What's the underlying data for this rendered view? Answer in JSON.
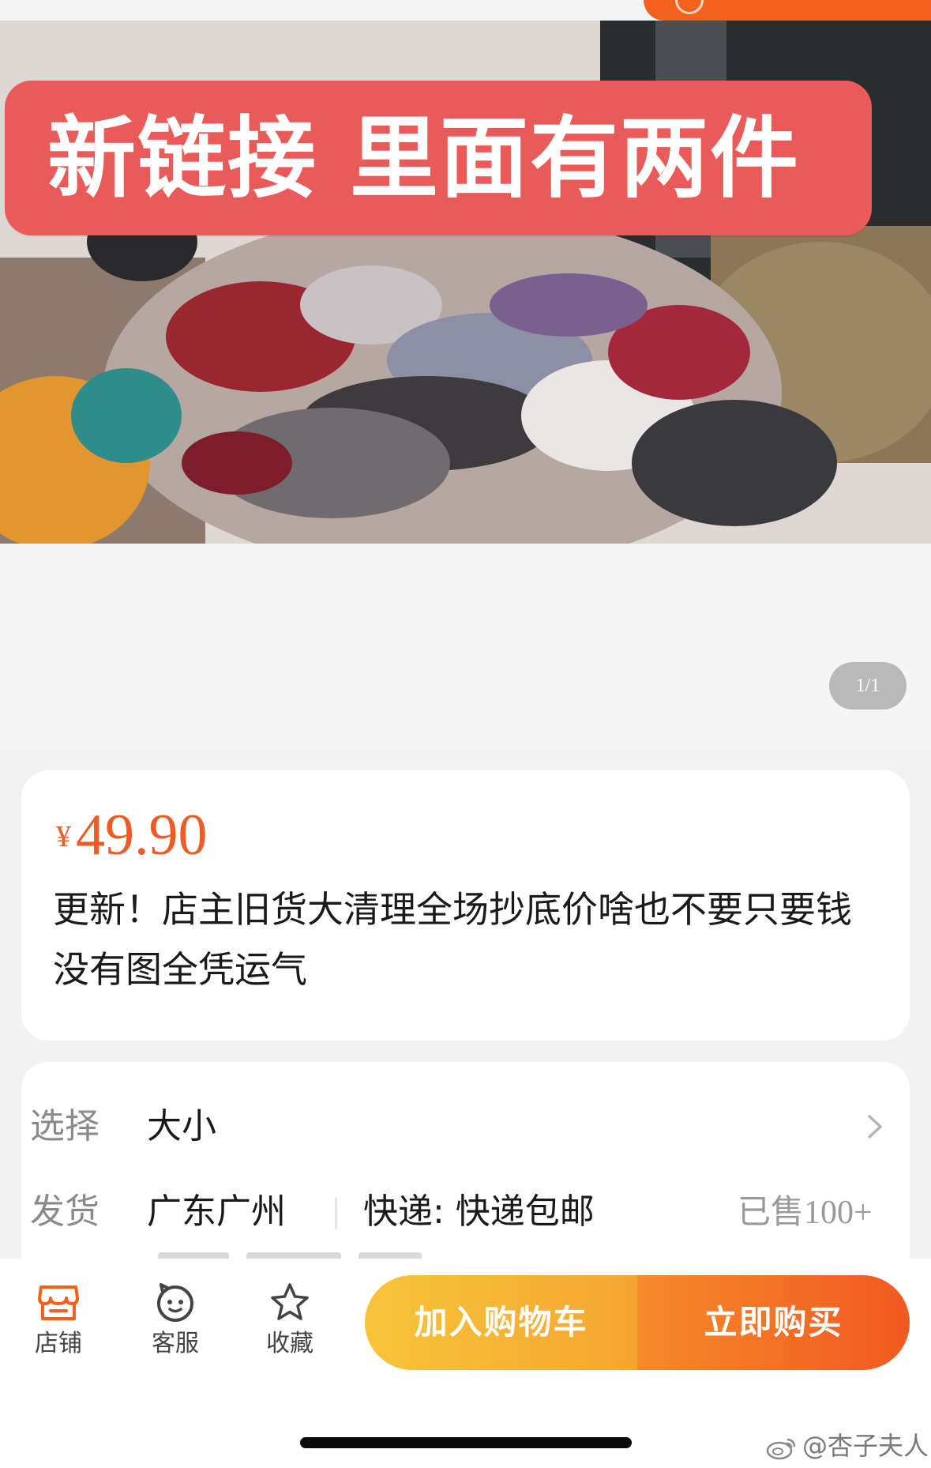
{
  "hero": {
    "banner_text": "新链接 里面有两件",
    "page_indicator": "1/1"
  },
  "product": {
    "currency_symbol": "¥",
    "price": "49.90",
    "title": "更新！店主旧货大清理全场抄底价啥也不要只要钱 没有图全凭运气"
  },
  "details": {
    "select_label": "选择",
    "select_value": "大小",
    "ship_label": "发货",
    "ship_origin": "广东广州",
    "express": "快递: 快递包邮",
    "sold_prefix": "已售",
    "sold_count": "100+"
  },
  "bottom_nav": {
    "shop": "店铺",
    "service": "客服",
    "favorite": "收藏",
    "add_to_cart": "加入购物车",
    "buy_now": "立即购买"
  },
  "watermark": "@杏子夫人",
  "colors": {
    "accent": "#ee5c26",
    "banner": "#ea5a59",
    "cart_button": "#f7c43a",
    "buy_button": "#f1591f"
  },
  "icons": [
    "shop-icon",
    "service-face-icon",
    "star-icon",
    "chevron-right-icon",
    "weibo-icon"
  ]
}
